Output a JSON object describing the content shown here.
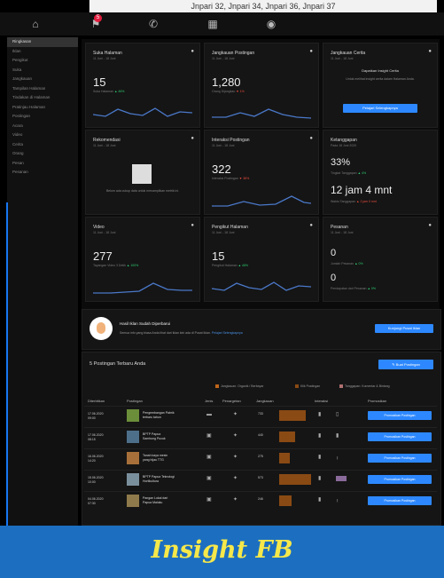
{
  "top_tab": {
    "text": "Jnpari 32, Jnpari 34, Jnpari 36, Jnpari 37"
  },
  "nav": {
    "notification_count": "5"
  },
  "sidebar": {
    "items": [
      {
        "label": "Ringkasan",
        "active": true
      },
      {
        "label": "Iklan"
      },
      {
        "label": "Pengikut"
      },
      {
        "label": "Suka"
      },
      {
        "label": "Jangkauan"
      },
      {
        "label": "Tampilan Halaman"
      },
      {
        "label": "Tindakan di Halaman"
      },
      {
        "label": "Pratinjau Halaman"
      },
      {
        "label": "Postingan"
      },
      {
        "label": "Acara"
      },
      {
        "label": "Video"
      },
      {
        "label": "Cerita"
      },
      {
        "label": "Orang"
      },
      {
        "label": "Pesan"
      },
      {
        "label": "Pesanan"
      }
    ]
  },
  "cards": {
    "suka": {
      "title": "Suka Halaman",
      "date": "11 Juni - 18 Juni",
      "value": "15",
      "sub": "Suka Halaman",
      "change": "▲ 46%"
    },
    "jangkauan": {
      "title": "Jangkauan Postingan",
      "date": "11 Juni - 18 Juni",
      "value": "1,280",
      "sub": "Orang Dijangkau",
      "change": "▼ 1%"
    },
    "cerita": {
      "title": "Jangkauan Cerita",
      "date": "11 Juni - 18 Juni",
      "heading": "Dapatkan Insight Cerita",
      "body": "Untuk melihat insight cerita dalam Halaman Anda.",
      "button": "Pelajari Selengkapnya"
    },
    "rekomendasi": {
      "title": "Rekomendasi",
      "date": "11 Juni - 18 Juni",
      "body": "Belum ada cukup data untuk menampilkan metrik ini."
    },
    "interaksi": {
      "title": "Interaksi Postingan",
      "date": "11 Juni - 18 Juni",
      "value": "322",
      "sub": "Interaksi Postingan",
      "change": "▼ 38%"
    },
    "ketanggapan": {
      "title": "Ketanggapan",
      "date": "Pada 18 Juni 2020",
      "value1": "33%",
      "sub1": "Tingkat Tanggapan",
      "change1": "▲ 4%",
      "value2": "12 jam 4 mnt",
      "sub2": "Waktu Tanggapan",
      "change2": "▲ 2 jam 0 mnt"
    },
    "video": {
      "title": "Video",
      "date": "11 Juni - 18 Juni",
      "value": "277",
      "sub": "Tayangan Video 3 Detik",
      "change": "▲ 100%"
    },
    "pengikut": {
      "title": "Pengikut Halaman",
      "date": "11 Juni - 18 Juni",
      "value": "15",
      "sub": "Pengikut Halaman",
      "change": "▲ 46%"
    },
    "pesanan": {
      "title": "Pesanan",
      "date": "11 Juni - 18 Juni",
      "value1": "0",
      "sub1": "Jumlah Pesanan",
      "change1": "▲ 0%",
      "value2": "0",
      "sub2": "Pendapatan dari Pesanan",
      "change2": "▲ 0%"
    }
  },
  "promo": {
    "title": "Hasil Iklan Sudah Diperbarui",
    "body": "Semua info yang biasa Anda lihat dari iklan kini ada di Pusat Iklan.",
    "link": "Pelajari Selengkapnya",
    "button": "Kunjungi Pusat Iklan"
  },
  "table": {
    "title": "5 Postingan Terbaru Anda",
    "create_button": "Buat Postingan",
    "legend": [
      "Jangkauan: Organik / Berbayar",
      "Klik Postingan",
      "Tanggapan: Komentar & Bintang"
    ],
    "headers": [
      "Diterbitkan",
      "Postingan",
      "Jenis",
      "Penargetan",
      "Jangkauan",
      "Interaksi",
      "Promosikan"
    ],
    "rows": [
      {
        "date": "17.06.2020",
        "time": "09:00",
        "post": "Pengembangan Pabrik terbaru tahun",
        "reach": "733",
        "promote": "Promosikan Postingan"
      },
      {
        "date": "17.06.2020",
        "time": "08:15",
        "post": "BPTP Papua Sambung Pucuk",
        "reach": "440",
        "promote": "Promosikan Postingan"
      },
      {
        "date": "16.06.2020",
        "time": "14:20",
        "post": "Tanah kaya mesin yang hijau TTG",
        "reach": "275",
        "promote": "Promosikan Postingan"
      },
      {
        "date": "15.06.2020",
        "time": "10:00",
        "post": "BPTP Papua Teknologi Hortikultura",
        "reach": "573",
        "promote": "Promosikan Postingan"
      },
      {
        "date": "04.06.2020",
        "time": "07:30",
        "post": "Pangan Lokal dari Papua Maluku",
        "reach": "246",
        "promote": "Promosikan Postingan"
      }
    ]
  },
  "footer": {
    "title": "Insight FB"
  }
}
